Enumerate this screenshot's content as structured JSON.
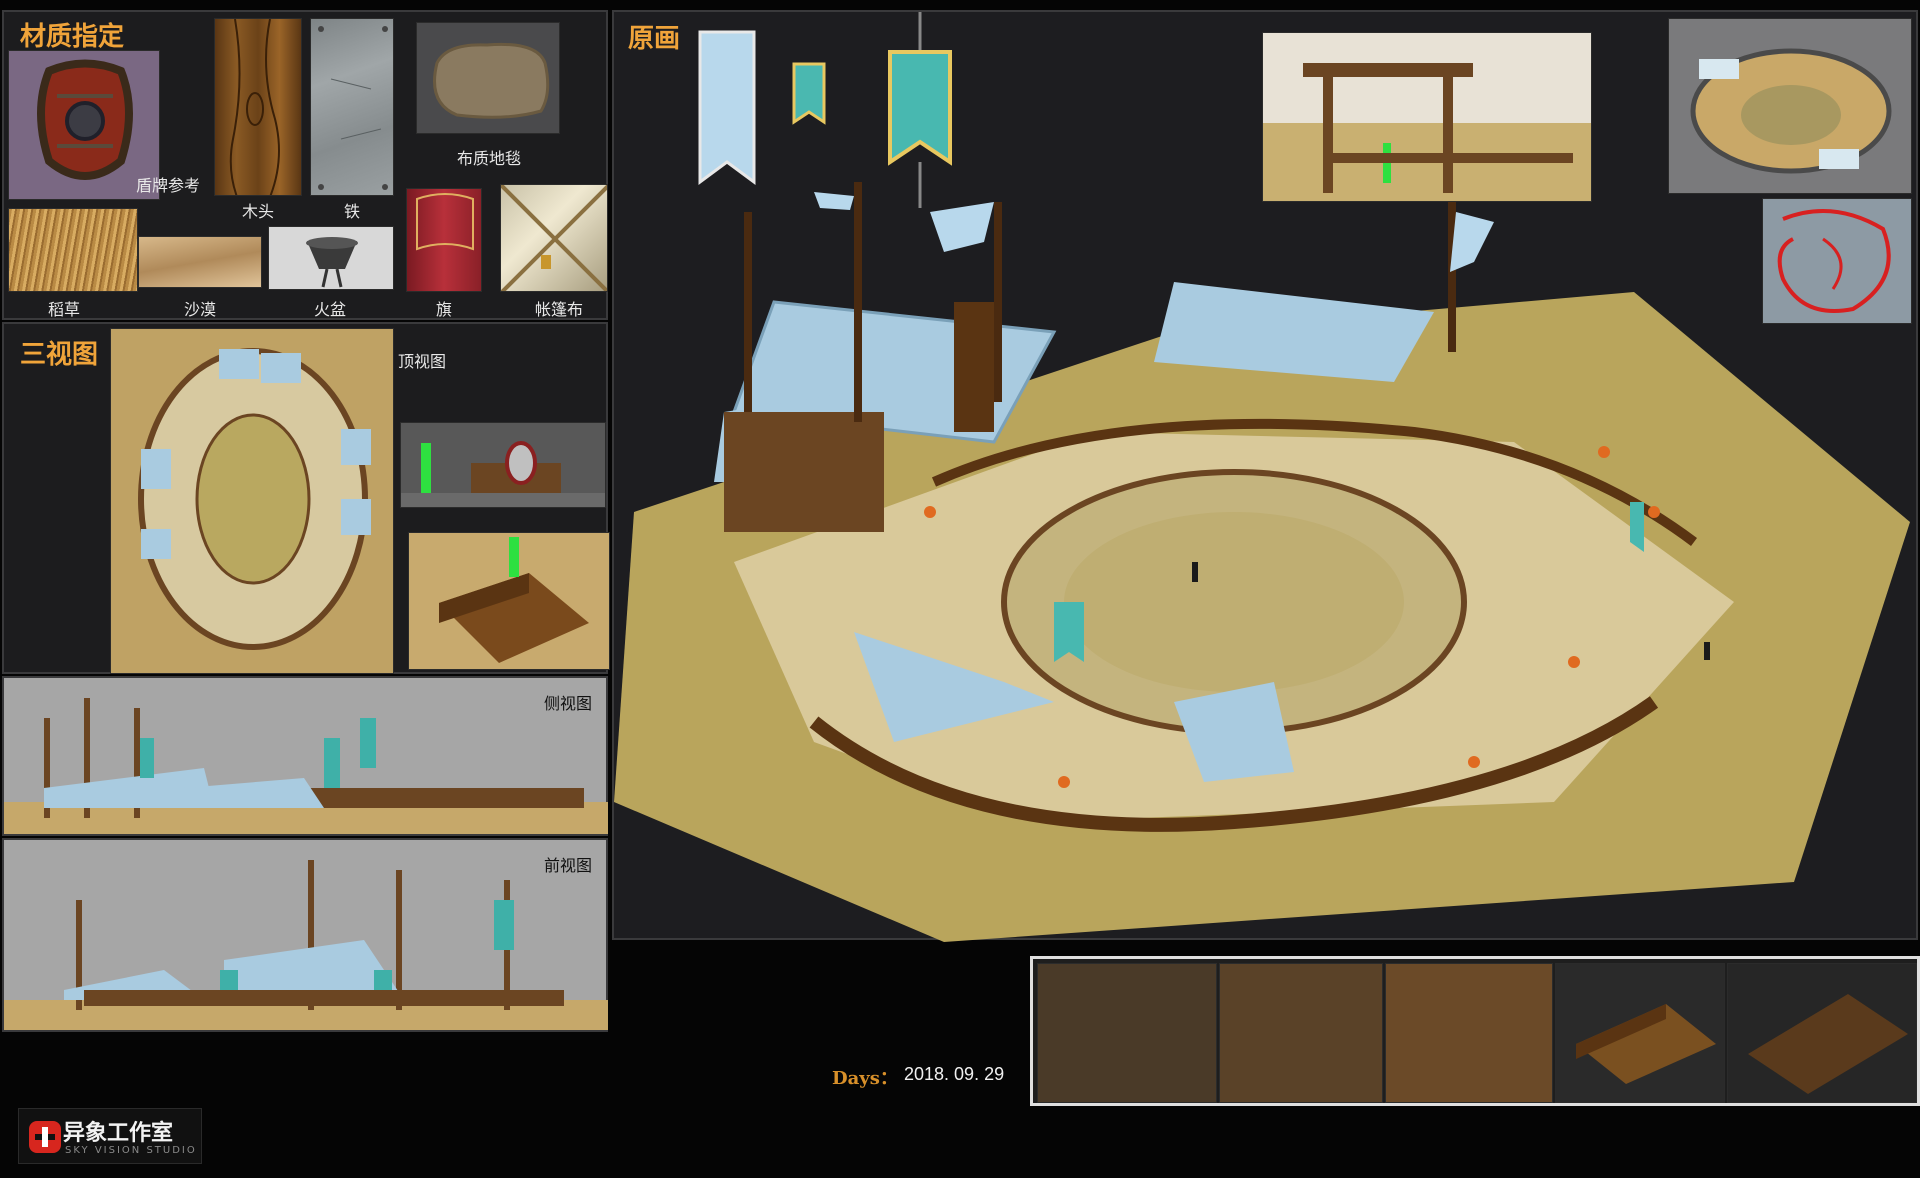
{
  "materials": {
    "title": "材质指定",
    "items": {
      "shield": "盾牌参考",
      "wood": "木头",
      "iron": "铁",
      "carpet": "布质地毯",
      "straw": "稻草",
      "desert": "沙漠",
      "brazier": "火盆",
      "flag": "旗",
      "tent_cloth": "帐篷布"
    }
  },
  "three_views": {
    "title": "三视图",
    "top": "顶视图",
    "side": "侧视图",
    "front": "前视图"
  },
  "concept": {
    "title": "原画"
  },
  "footer": {
    "days_label": "Days：",
    "date": "2018. 09. 29",
    "studio_name": "异象工作室",
    "studio_sub": "SKY VISION STUDIO"
  },
  "colors": {
    "accent": "#f0a43a",
    "panel": "#1c1c1e",
    "sand": "#c9b071",
    "tent": "#a9cbe0",
    "wood": "#6b4522",
    "logo_red": "#d7261e"
  }
}
